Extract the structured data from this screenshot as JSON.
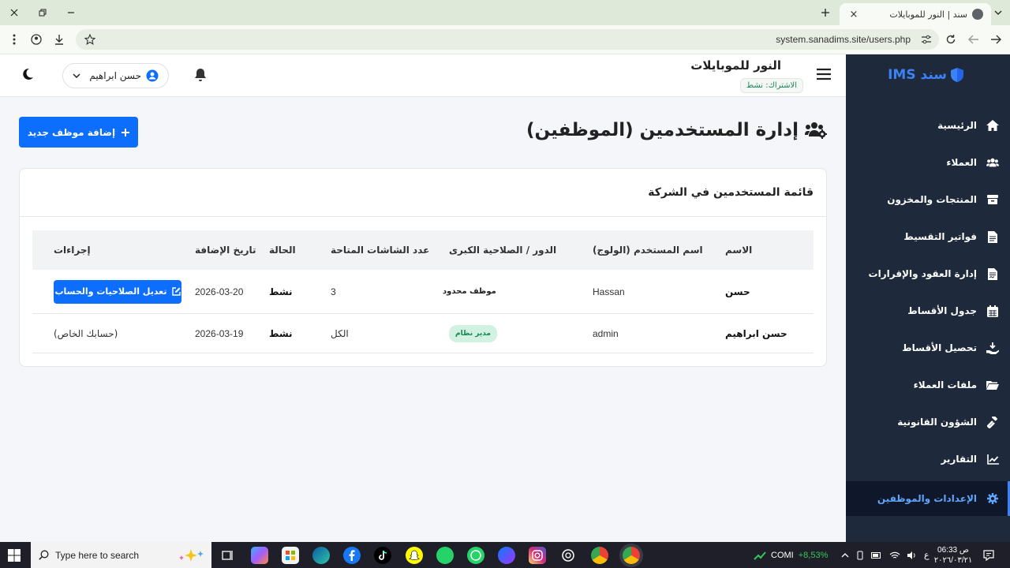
{
  "browser": {
    "tab_title": "سند | النور للموبايلات",
    "url": "system.sanadims.site/users.php"
  },
  "header": {
    "shop_name": "النور للموبايلات",
    "subscription": "الاشتراك: نشط",
    "user_name": "حسن ابراهيم"
  },
  "sidebar": {
    "brand": "سند IMS",
    "items": [
      {
        "label": "الرئيسية",
        "icon": "home-icon"
      },
      {
        "label": "العملاء",
        "icon": "users-icon"
      },
      {
        "label": "المنتجات والمخزون",
        "icon": "box-icon"
      },
      {
        "label": "فواتير التقسيط",
        "icon": "file-icon"
      },
      {
        "label": "إدارة العقود والإقرارات",
        "icon": "file-contract-icon"
      },
      {
        "label": "جدول الأقساط",
        "icon": "calendar-icon"
      },
      {
        "label": "تحصيل الأقساط",
        "icon": "hand-money-icon"
      },
      {
        "label": "ملفات العملاء",
        "icon": "folder-icon"
      },
      {
        "label": "الشؤون القانونية",
        "icon": "gavel-icon"
      },
      {
        "label": "التقارير",
        "icon": "chart-line-icon"
      },
      {
        "label": "الإعدادات والموظفين",
        "icon": "gear-icon",
        "active": true
      }
    ]
  },
  "page": {
    "title": "إدارة المستخدمين (الموظفين)",
    "add_button": "إضافة موظف جديد",
    "card_title": "قائمة المستخدمين في الشركة"
  },
  "table": {
    "headers": [
      "الاسم",
      "اسم المستخدم (الولوج)",
      "الدور / الصلاحية الكبرى",
      "عدد الشاشات المتاحة",
      "الحالة",
      "تاريخ الإضافة",
      "إجراءات"
    ],
    "rows": [
      {
        "name": "حسن",
        "username": "Hassan",
        "role": "موظف محدود",
        "screens": "3",
        "status": "نشط",
        "date": "2026-03-20",
        "action": "تعديل الصلاحيات والحساب"
      },
      {
        "name": "حسن ابراهيم",
        "username": "admin",
        "role": "مدير نظام",
        "screens": "الكل",
        "status": "نشط",
        "date": "2026-03-19",
        "action": "(حسابك الخاص)"
      }
    ]
  },
  "taskbar": {
    "search_placeholder": "Type here to search",
    "stock_name": "COMI",
    "stock_change": "+8,53%",
    "time": "06:33 ص",
    "date": "٢٠٢٦/٠٣/٢١",
    "lang": "ع"
  },
  "colors": {
    "primary": "#0d6efd",
    "sidebar_bg": "#1e293b",
    "success": "#198754"
  }
}
